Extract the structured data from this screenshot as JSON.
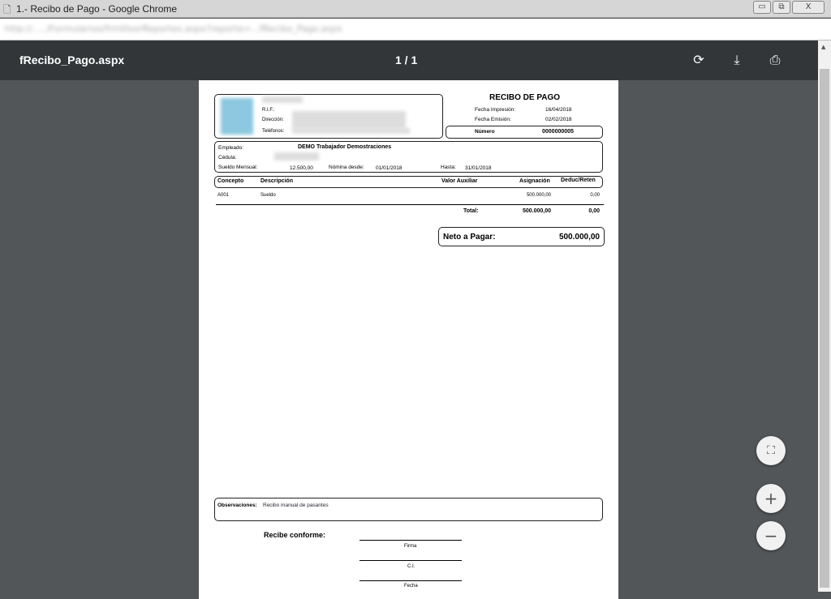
{
  "window": {
    "title": "1.- Recibo de Pago - Google Chrome",
    "min": "▭",
    "restore": "⧉",
    "close": "X"
  },
  "address": {
    "url": "http://...../Formularios/frmVisorReportes.aspx?reporte=...fRecibo_Pago.aspx"
  },
  "viewer": {
    "filename": "fRecibo_Pago.aspx",
    "page_indicator": "1  /  1",
    "rotate_icon": "⟳",
    "download_icon": "⤓",
    "print_icon": "⎙",
    "fit_icon": "⛶",
    "zoom_in": "+",
    "zoom_out": "−"
  },
  "receipt": {
    "title": "RECIBO DE PAGO",
    "company": {
      "rif_label": "R.I.F.:",
      "direccion_label": "Dirección:",
      "telefonos_label": "Teléfonos:"
    },
    "fecha_impresion_label": "Fecha Impresión:",
    "fecha_impresion": "16/04/2018",
    "fecha_emision_label": "Fecha Emisión:",
    "fecha_emision": "02/02/2018",
    "numero_label": "Número",
    "numero": "0000000005",
    "empleado_label": "Empleado:",
    "empleado": "DEMO Trabajador Demostraciones",
    "cedula_label": "Cédula:",
    "sueldo_label": "Sueldo  Mensual:",
    "sueldo": "12.500,00",
    "nomina_desde_label": "Nómina desde:",
    "nomina_desde": "01/01/2018",
    "hasta_label": "Hasta:",
    "hasta": "31/01/2018",
    "columns": [
      "Concepto",
      "Descripción",
      "Valor Auxiliar",
      "Asignación",
      "Deduc/Reten"
    ],
    "rows": [
      {
        "concepto": "A001",
        "descripcion": "Sueldo",
        "valor_auxiliar": "",
        "asignacion": "500.000,00",
        "deduccion": "0,00"
      }
    ],
    "total_label": "Total:",
    "total_asignacion": "500.000,00",
    "total_deduccion": "0,00",
    "neto_label": "Neto a Pagar:",
    "neto": "500.000,00",
    "observaciones_label": "Observaciones:",
    "observaciones": "Recibo manual de pasantes",
    "recibe_label": "Recibe conforme:",
    "firma_label": "Firma",
    "ci_label": "C.I.",
    "fecha_label": "Fecha"
  }
}
